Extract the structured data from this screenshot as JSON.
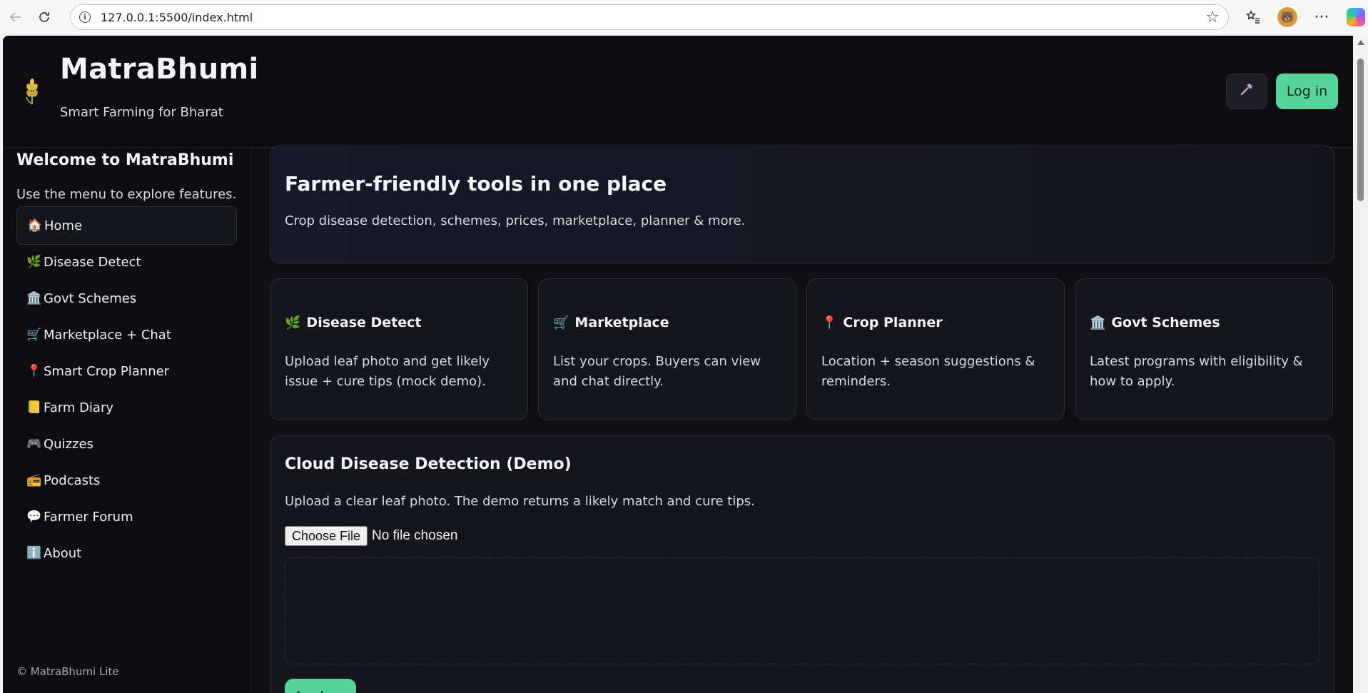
{
  "browser": {
    "url": "127.0.0.1:5500/index.html",
    "icons": {
      "back": "back-arrow-icon",
      "reload": "reload-icon",
      "info": "info-icon",
      "favorite": "star-icon",
      "favorites_list": "favorites-icon",
      "more": "more-icon"
    },
    "more_glyph": "···"
  },
  "header": {
    "title": "MatraBhumi",
    "tagline": "Smart Farming for Bharat",
    "theme_toggle_icon": "hammer-icon",
    "login_label": "Log in"
  },
  "sidebar": {
    "title": "Welcome to MatraBhumi",
    "subtitle": "Use the menu to explore features.",
    "items": [
      {
        "emoji": "🏠",
        "label": "Home",
        "active": true
      },
      {
        "emoji": "🌿",
        "label": "Disease Detect"
      },
      {
        "emoji": "🏛️",
        "label": "Govt Schemes"
      },
      {
        "emoji": "🛒",
        "label": "Marketplace + Chat"
      },
      {
        "emoji": "📍",
        "label": "Smart Crop Planner"
      },
      {
        "emoji": "📒",
        "label": "Farm Diary"
      },
      {
        "emoji": "🎮",
        "label": "Quizzes"
      },
      {
        "emoji": "📻",
        "label": "Podcasts"
      },
      {
        "emoji": "💬",
        "label": "Farmer Forum"
      },
      {
        "emoji": "ℹ️",
        "label": "About"
      }
    ],
    "footer": "© MatraBhumi Lite"
  },
  "hero": {
    "title": "Farmer-friendly tools in one place",
    "subtitle": "Crop disease detection, schemes, prices, marketplace, planner & more."
  },
  "cards": [
    {
      "emoji": "🌿",
      "title": "Disease Detect",
      "desc": "Upload leaf photo and get likely issue + cure tips (mock demo)."
    },
    {
      "emoji": "🛒",
      "title": "Marketplace",
      "desc": "List your crops. Buyers can view and chat directly."
    },
    {
      "emoji": "📍",
      "title": "Crop Planner",
      "desc": "Location + season suggestions & reminders."
    },
    {
      "emoji": "🏛️",
      "title": "Govt Schemes",
      "desc": "Latest programs with eligibility & how to apply."
    }
  ],
  "detection": {
    "title": "Cloud Disease Detection (Demo)",
    "subtitle": "Upload a clear leaf photo. The demo returns a likely match and cure tips.",
    "file_button": "Choose File",
    "file_status": "No file chosen",
    "analyze_label": "Analyze"
  },
  "colors": {
    "accent": "#57d39b",
    "background": "#0f0f13",
    "panel": "#15161c"
  }
}
